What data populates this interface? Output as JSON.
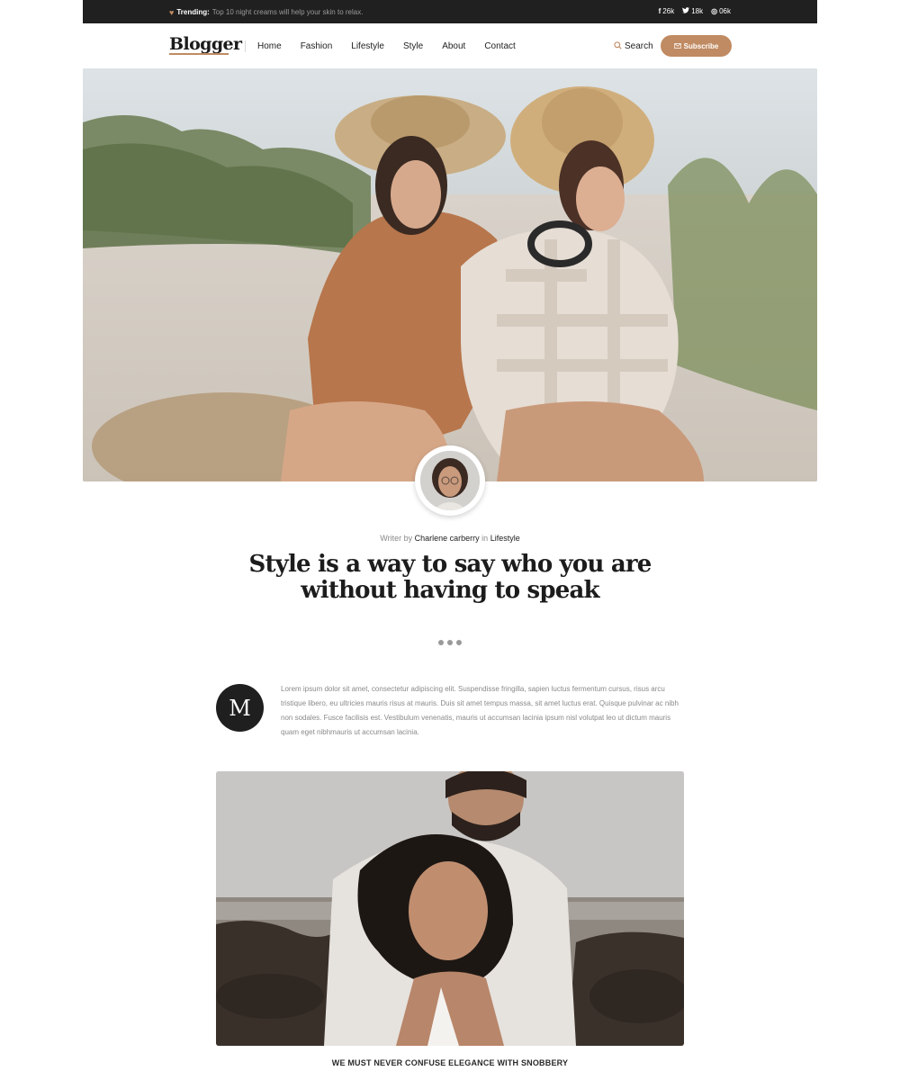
{
  "topbar": {
    "trending_label": "Trending:",
    "trending_text": "Top 10 night creams will help your skin to relax.",
    "socials": [
      {
        "icon": "facebook-icon",
        "glyph": "f",
        "count": "26k"
      },
      {
        "icon": "twitter-icon",
        "glyph": "t",
        "count": "18k"
      },
      {
        "icon": "dribbble-icon",
        "glyph": "◎",
        "count": "06k"
      }
    ]
  },
  "nav": {
    "logo": "Blogger",
    "links": [
      "Home",
      "Fashion",
      "Lifestyle",
      "Style",
      "About",
      "Contact"
    ],
    "search_label": "Search",
    "subscribe_label": "Subscribe"
  },
  "post": {
    "writer_prefix": "Writer by",
    "author": "Charlene carberry",
    "in_word": "in",
    "category": "Lifestyle",
    "title": "Style is a way to say who you are without having to speak",
    "dropcap": "M",
    "paragraph": "Lorem ipsum dolor sit amet, consectetur adipiscing elit. Suspendisse fringilla, sapien luctus fermentum cursus, risus arcu tristique libero, eu ultricies mauris risus at mauris. Duis sit amet tempus massa, sit amet luctus erat. Quisque pulvinar ac nibh non sodales. Fusce facilisis est. Vestibulum venenatis, mauris ut accumsan lacinia ipsum nisl volutpat leo ut dictum mauris quam eget nibhmauris ut accumsan lacinia.",
    "caption": "WE MUST NEVER CONFUSE ELEGANCE WITH SNOBBERY"
  },
  "colors": {
    "accent": "#c08a62",
    "topbar_bg": "#202020",
    "dark": "#1f1f1f"
  }
}
